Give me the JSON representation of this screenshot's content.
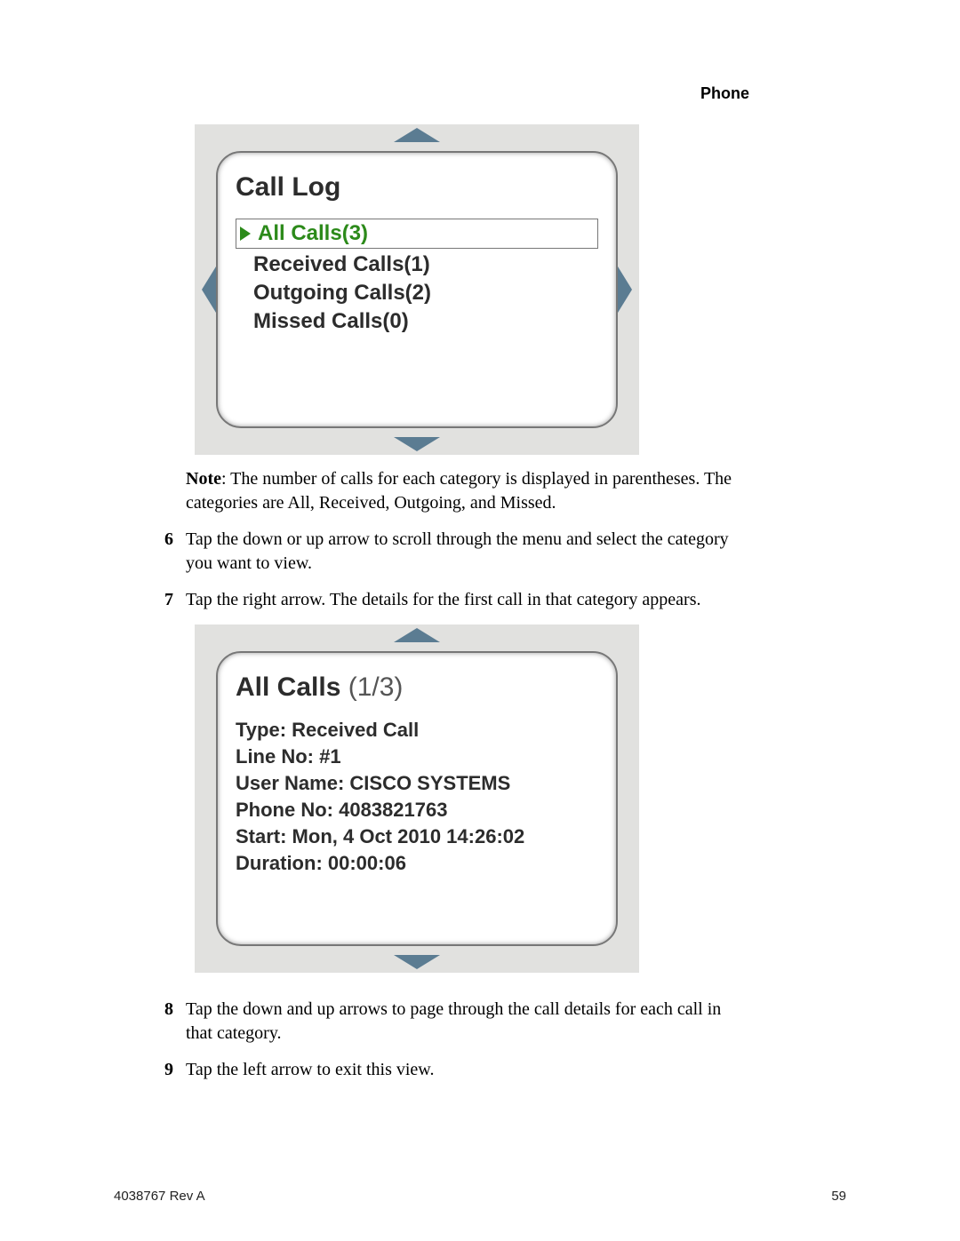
{
  "header": {
    "section": "Phone"
  },
  "screenshot1": {
    "title": "Call Log",
    "selected": "All Calls(3)",
    "rows": [
      "Received Calls(1)",
      "Outgoing Calls(2)",
      "Missed Calls(0)"
    ]
  },
  "note": {
    "label": "Note",
    "text": ": The number of calls for each category is displayed in parentheses. The categories are All, Received, Outgoing, and Missed."
  },
  "steps": {
    "s6": {
      "num": "6",
      "text": "Tap the down or up arrow to scroll through the menu and select the category you want to view."
    },
    "s7": {
      "num": "7",
      "text": "Tap the right arrow. The details for the first call in that category appears."
    },
    "s8": {
      "num": "8",
      "text": "Tap the down and up arrows to page through the call details for each call in that category."
    },
    "s9": {
      "num": "9",
      "text": "Tap the left arrow to exit this view."
    }
  },
  "screenshot2": {
    "title_main": "All Calls ",
    "title_counter": "(1/3)",
    "lines": [
      "Type: Received Call",
      "Line No: #1",
      "User Name: CISCO SYSTEMS",
      "Phone No: 4083821763",
      "Start: Mon, 4 Oct 2010 14:26:02",
      "Duration: 00:00:06"
    ]
  },
  "footer": {
    "left": "4038767 Rev A",
    "right": "59"
  }
}
